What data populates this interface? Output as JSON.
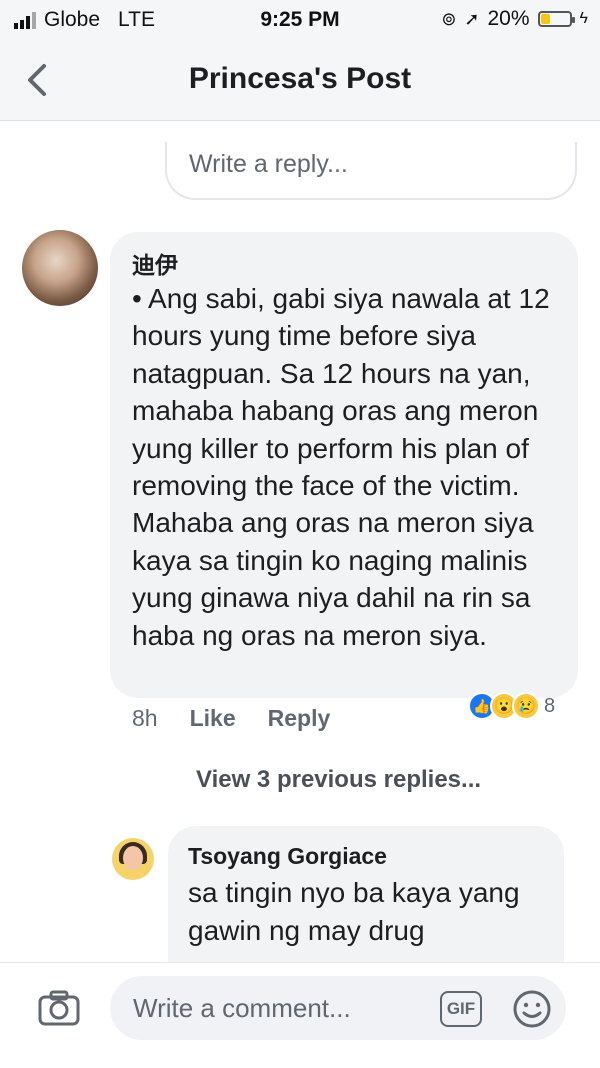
{
  "status_bar": {
    "carrier": "Globe",
    "network": "LTE",
    "time": "9:25 PM",
    "battery": "20%",
    "battery_level": 0.2
  },
  "header": {
    "title": "Princesa's Post"
  },
  "reply_box": {
    "placeholder": "Write a reply..."
  },
  "comments": [
    {
      "author": "迪伊",
      "text": "• Ang sabi, gabi siya nawala at 12 hours yung time before siya natagpuan. Sa 12 hours na yan, mahaba habang oras ang meron yung killer to perform his plan of removing the face of the victim. Mahaba ang oras na meron siya kaya sa tingin ko naging malinis yung ginawa niya dahil na rin sa haba ng oras na meron siya.",
      "time": "8h",
      "like_label": "Like",
      "reply_label": "Reply",
      "reactions": [
        "like",
        "wow",
        "sad"
      ],
      "reaction_count": "8"
    }
  ],
  "view_previous": "View 3 previous replies...",
  "replies": [
    {
      "author": "Tsoyang Gorgiace",
      "text": "sa tingin nyo ba kaya yang gawin ng may drug"
    }
  ],
  "composer": {
    "placeholder": "Write a comment...",
    "gif_label": "GIF"
  }
}
